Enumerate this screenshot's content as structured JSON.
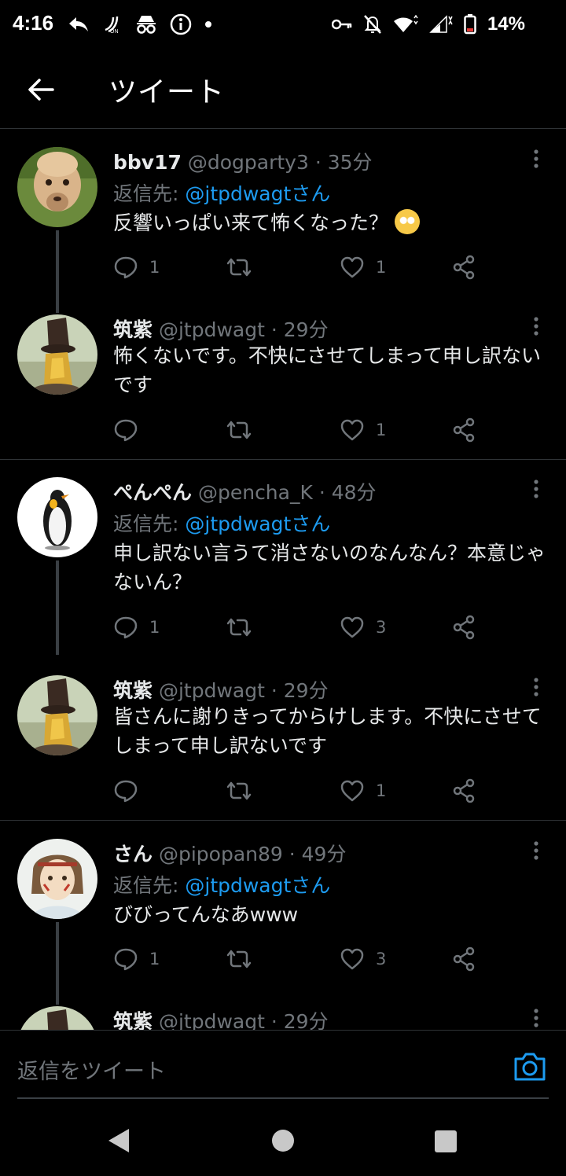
{
  "status_bar": {
    "time": "4:16",
    "battery": "14%",
    "left_icons": [
      "reply-arrow-icon",
      "nfc-icon",
      "incognito-icon",
      "info-icon",
      "dot-icon"
    ],
    "right_icons": [
      "vpn-key-icon",
      "bell-off-icon",
      "wifi-icon",
      "signal-icon",
      "battery-icon"
    ]
  },
  "header": {
    "title": "ツイート",
    "back_icon": "back-arrow-icon"
  },
  "tweets": [
    {
      "name": "bbv17",
      "handle": "@dogparty3",
      "time": "· 35分",
      "reply_prefix": "返信先: ",
      "reply_to": "@jtpdwagtさん",
      "text": "反響いっぱい来て怖くなった？",
      "emoji": "🥺",
      "replies": "1",
      "retweets": "",
      "likes": "1"
    },
    {
      "name": "筑紫",
      "handle": "@jtpdwagt",
      "time": "· 29分",
      "text": "怖くないです。不快にさせてしまって申し訳ないです",
      "replies": "",
      "retweets": "",
      "likes": "1"
    },
    {
      "name": "ぺんぺん",
      "handle": "@pencha_K",
      "time": "· 48分",
      "reply_prefix": "返信先: ",
      "reply_to": "@jtpdwagtさん",
      "text": "申し訳ない言うて消さないのなんなん？本意じゃないん？",
      "replies": "1",
      "retweets": "",
      "likes": "3"
    },
    {
      "name": "筑紫",
      "handle": "@jtpdwagt",
      "time": "· 29分",
      "text": "皆さんに謝りきってからけします。不快にさせてしまって申し訳ないです",
      "replies": "",
      "retweets": "",
      "likes": "1"
    },
    {
      "name": "さん",
      "handle": "@pipopan89",
      "time": "· 49分",
      "reply_prefix": "返信先: ",
      "reply_to": "@jtpdwagtさん",
      "text": "びびってんなあwww",
      "replies": "1",
      "retweets": "",
      "likes": "3"
    },
    {
      "name": "筑紫",
      "handle": "@jtpdwagt",
      "time": "· 29分"
    }
  ],
  "compose": {
    "placeholder": "返信をツイート",
    "camera_icon": "camera-icon"
  },
  "colors": {
    "background": "#000000",
    "accent": "#1d9bf0",
    "muted": "#71767b",
    "text": "#e7e9ea"
  }
}
